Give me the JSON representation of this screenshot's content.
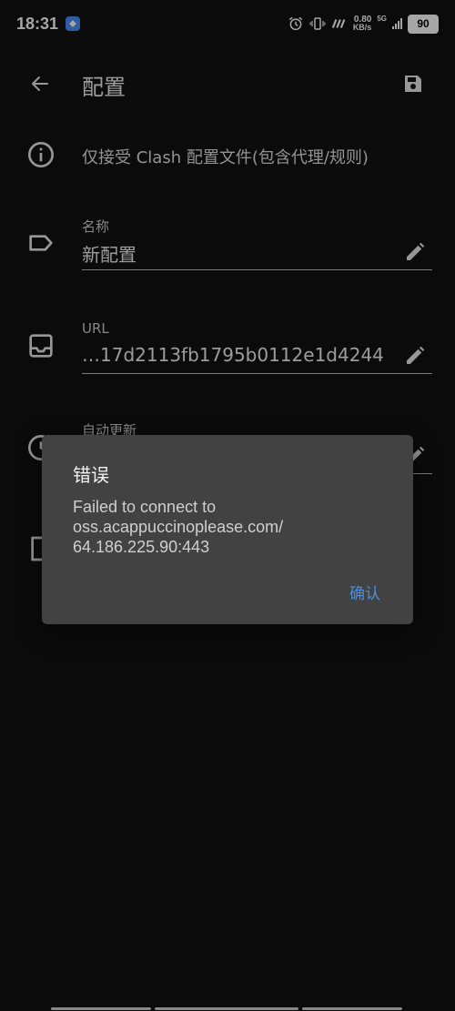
{
  "status_bar": {
    "time": "18:31",
    "speed_value": "0.80",
    "speed_unit": "KB/s",
    "network_type": "5G",
    "battery": "90"
  },
  "app_bar": {
    "title": "配置"
  },
  "info": {
    "text": "仅接受 Clash 配置文件(包含代理/规则)"
  },
  "fields": {
    "name": {
      "label": "名称",
      "value": "新配置"
    },
    "url": {
      "label": "URL",
      "value": "…17d2113fb1795b0112e1d4244"
    },
    "auto_update": {
      "label": "自动更新"
    }
  },
  "dialog": {
    "title": "错误",
    "message": "Failed to connect to\noss.acappuccinoplease.com/\n64.186.225.90:443",
    "confirm_label": "确认"
  },
  "colors": {
    "background": "#111111",
    "dialog": "#424242",
    "accent": "#4a90e2"
  }
}
